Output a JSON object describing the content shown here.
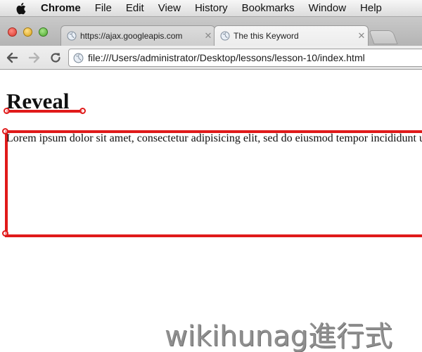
{
  "menubar": {
    "app_name": "Chrome",
    "items": [
      "File",
      "Edit",
      "View",
      "History",
      "Bookmarks",
      "Window",
      "Help"
    ]
  },
  "tabs": [
    {
      "label": "https://ajax.googleapis.com",
      "active": false
    },
    {
      "label": "The this Keyword",
      "active": true
    }
  ],
  "toolbar": {
    "url": "file:///Users/administrator/Desktop/lessons/lesson-10/index.html"
  },
  "page": {
    "heading": "Reveal",
    "paragraph": "Lorem ipsum dolor sit amet, consectetur adipisicing elit, sed do eiusmod tempor incididunt ut labore"
  },
  "watermark": "wikihunag進行式",
  "colors": {
    "highlight": "#e01a1a"
  }
}
